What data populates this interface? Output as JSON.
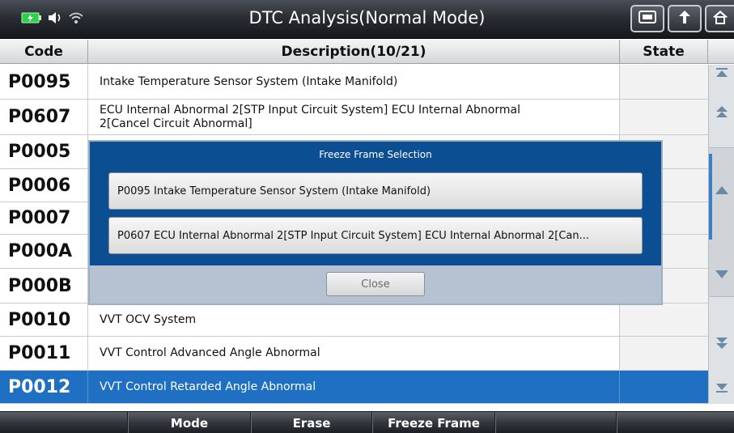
{
  "window": {
    "title": "DTC Analysis(Normal Mode)"
  },
  "status_icons": [
    "battery-icon",
    "speaker-icon",
    "wifi-icon"
  ],
  "top_buttons": [
    "screenshot-icon",
    "back-icon",
    "home-icon"
  ],
  "table": {
    "headers": {
      "code": "Code",
      "description": "Description(10/21)",
      "state": "State"
    },
    "rows": [
      {
        "code": "P0095",
        "description": "Intake Temperature Sensor System (Intake Manifold)",
        "state": ""
      },
      {
        "code": "P0607",
        "description": "ECU Internal Abnormal 2[STP Input Circuit System] ECU Internal Abnormal 2[Cancel Circuit Abnormal]",
        "state": ""
      },
      {
        "code": "P0005",
        "description": "",
        "state": ""
      },
      {
        "code": "P0006",
        "description": "",
        "state": ""
      },
      {
        "code": "P0007",
        "description": "",
        "state": ""
      },
      {
        "code": "P000A",
        "description": "",
        "state": ""
      },
      {
        "code": "P000B",
        "description": "",
        "state": ""
      },
      {
        "code": "P0010",
        "description": "VVT OCV System",
        "state": ""
      },
      {
        "code": "P0011",
        "description": "VVT Control Advanced Angle Abnormal",
        "state": ""
      },
      {
        "code": "P0012",
        "description": "VVT Control Retarded Angle Abnormal",
        "state": "",
        "selected": true
      }
    ]
  },
  "modal": {
    "title": "Freeze Frame Selection",
    "items": [
      "P0095 Intake Temperature Sensor System (Intake Manifold)",
      "P0607 ECU Internal Abnormal 2[STP Input Circuit System] ECU Internal Abnormal 2[Can..."
    ],
    "close_label": "Close"
  },
  "bottom_bar": [
    "",
    "Mode",
    "Erase",
    "Freeze Frame",
    "",
    ""
  ],
  "colors": {
    "selected_row": "#1f6fc2",
    "modal_bg": "#0c4e92",
    "accent_scroll": "#3a7fc8"
  }
}
